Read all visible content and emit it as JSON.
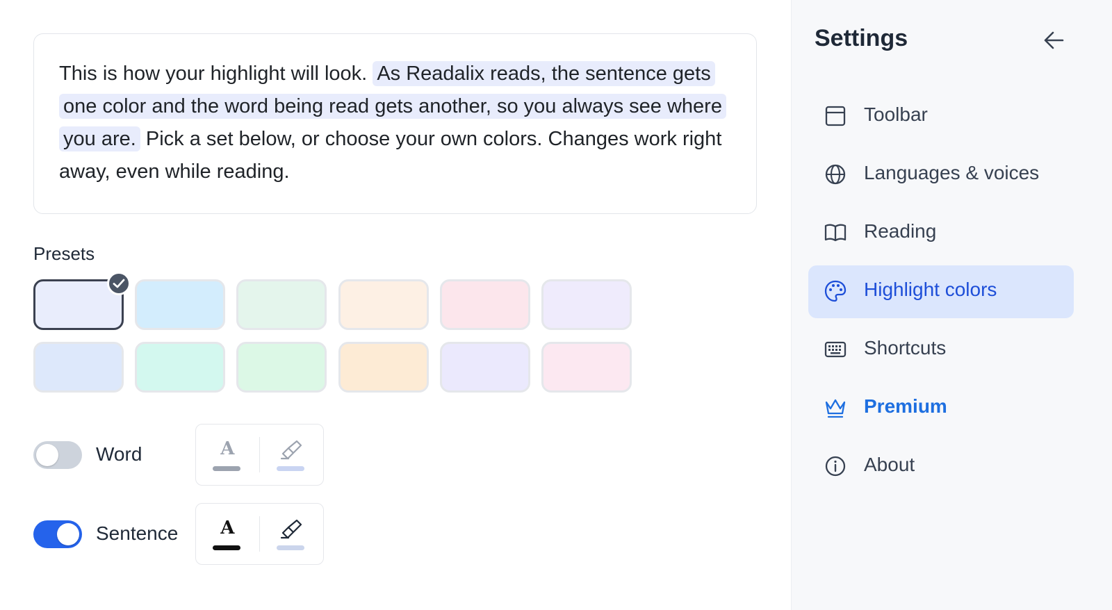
{
  "preview": {
    "intro": "This is how your highlight will look.",
    "sentence_part1": "As Readalix reads, the sentence gets one color and the",
    "word": "word",
    "sentence_part2": "being read gets another, so you always see where you are.",
    "outro": "Pick a set below, or choose your own colors. Changes work right away, even while reading."
  },
  "presets": {
    "label": "Presets",
    "selected_index": 0,
    "swatches": [
      {
        "color": "#e9edfc"
      },
      {
        "color": "#d3edfd"
      },
      {
        "color": "#e4f5ec"
      },
      {
        "color": "#fdf0e4"
      },
      {
        "color": "#fce6ec"
      },
      {
        "color": "#efebfc"
      },
      {
        "color": "#dde8fb"
      },
      {
        "color": "#d3f8ef"
      },
      {
        "color": "#dcf8e6"
      },
      {
        "color": "#fdebd5"
      },
      {
        "color": "#ebe9fd"
      },
      {
        "color": "#fce8f1"
      }
    ]
  },
  "word": {
    "label": "Word",
    "enabled": false,
    "text_color": "#9ca3af",
    "highlight_color": "#c9d4f2"
  },
  "sentence": {
    "label": "Sentence",
    "enabled": true,
    "text_color": "#111111",
    "highlight_color": "#cbd5ec"
  },
  "sidebar": {
    "title": "Settings",
    "items": [
      {
        "label": "Toolbar",
        "icon": "toolbar-icon"
      },
      {
        "label": "Languages & voices",
        "icon": "globe-icon"
      },
      {
        "label": "Reading",
        "icon": "book-icon"
      },
      {
        "label": "Highlight colors",
        "icon": "palette-icon",
        "active": true
      },
      {
        "label": "Shortcuts",
        "icon": "keyboard-icon"
      },
      {
        "label": "Premium",
        "icon": "crown-icon",
        "premium": true
      },
      {
        "label": "About",
        "icon": "info-icon"
      }
    ]
  },
  "colors": {
    "accent": "#2563eb",
    "active_bg": "#dbe6fd",
    "active_text": "#1d4ed8",
    "premium": "#1e6fe0"
  }
}
